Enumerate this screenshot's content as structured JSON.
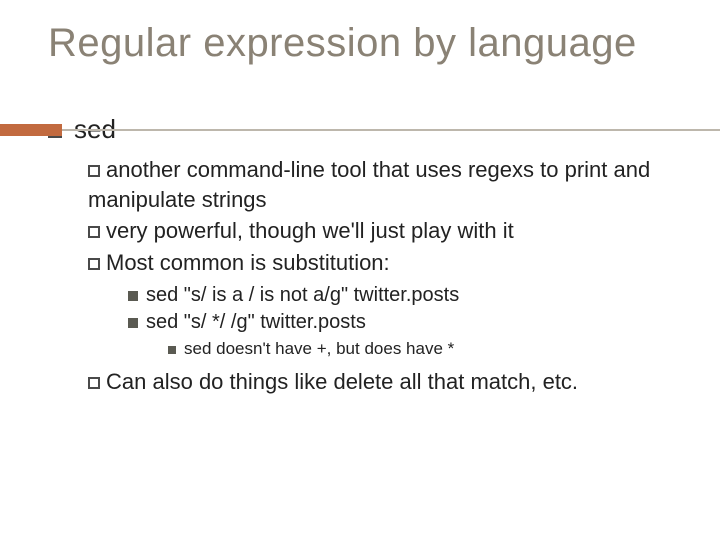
{
  "title": "Regular expression by language",
  "level1": {
    "item_label": "sed"
  },
  "level2": {
    "i0": "another command-line tool that uses regexs to print and manipulate strings",
    "i1": "very powerful, though we'll just play with it",
    "i2": "Most common is substitution:",
    "i3": "Can also do things like delete all that match, etc."
  },
  "level3": {
    "i0": "sed \"s/ is a / is not a/g\" twitter.posts",
    "i1": "sed \"s/  */ /g\" twitter.posts"
  },
  "level4": {
    "i0": "sed doesn't have +, but does have *"
  }
}
